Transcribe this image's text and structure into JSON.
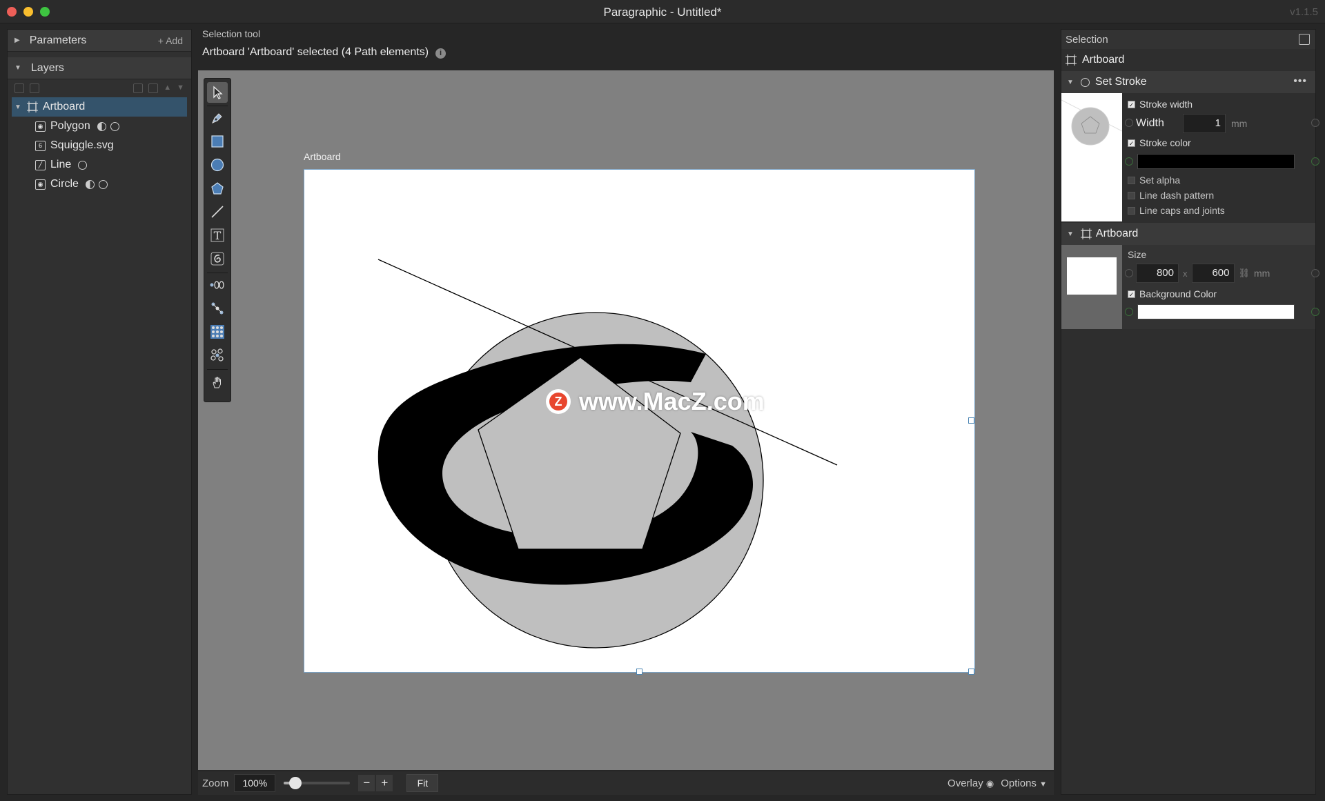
{
  "window": {
    "title": "Paragraphic - Untitled*",
    "version": "v1.1.5"
  },
  "parameters": {
    "label": "Parameters",
    "add_label": "+ Add"
  },
  "layers": {
    "label": "Layers",
    "items": [
      {
        "label": "Artboard",
        "icon": "artboard-icon",
        "selected": true
      },
      {
        "label": "Polygon",
        "icon": "path-node-icon"
      },
      {
        "label": "Squiggle.svg",
        "icon": "svg-icon"
      },
      {
        "label": "Line",
        "icon": "line-icon"
      },
      {
        "label": "Circle",
        "icon": "path-node-icon"
      }
    ]
  },
  "status": {
    "tool_name": "Selection tool",
    "selection_info": "Artboard 'Artboard' selected (4 Path elements)"
  },
  "canvas": {
    "artboard_label": "Artboard",
    "watermark_text": "www.MacZ.com",
    "watermark_logo": "Z"
  },
  "bottom_bar": {
    "zoom_label": "Zoom",
    "zoom_value": "100%",
    "zoom_slider_fraction": 0.17,
    "zoom_out": "−",
    "zoom_in": "+",
    "fit_label": "Fit",
    "overlay_label": "Overlay",
    "options_label": "Options"
  },
  "selection_panel": {
    "title": "Selection",
    "selected_item": "Artboard",
    "set_stroke": {
      "title": "Set Stroke",
      "stroke_width_label": "Stroke width",
      "width_label": "Width",
      "width_value": "1",
      "width_unit": "mm",
      "stroke_color_label": "Stroke color",
      "stroke_color": "#000000",
      "set_alpha_label": "Set alpha",
      "dash_label": "Line dash pattern",
      "caps_label": "Line caps and joints"
    },
    "artboard_node": {
      "title": "Artboard",
      "size_label": "Size",
      "width_value": "800",
      "x_label": "x",
      "height_value": "600",
      "unit": "mm",
      "bg_label": "Background Color",
      "bg_color": "#ffffff"
    }
  },
  "colors": {
    "accent": "#34536b",
    "shape_fill": "#bfbfbf",
    "squiggle": "#000000"
  }
}
